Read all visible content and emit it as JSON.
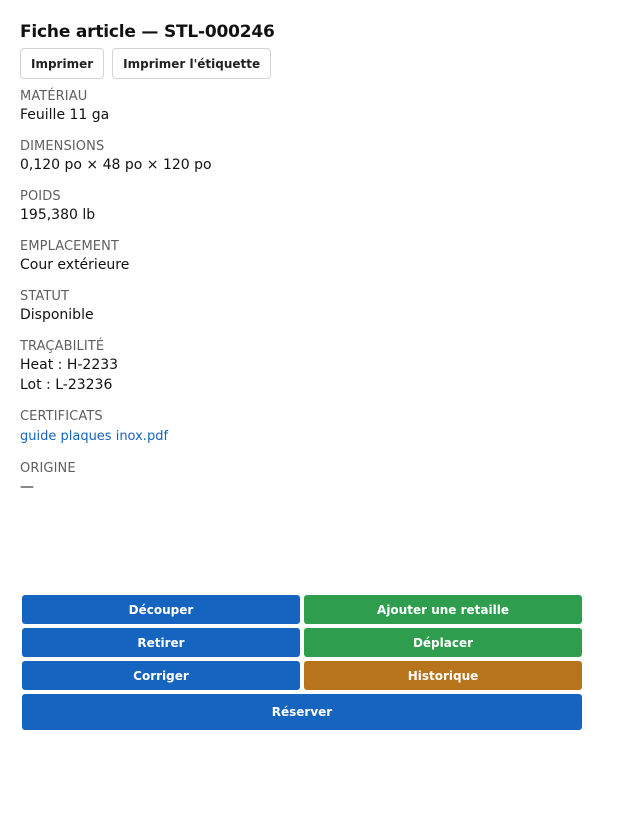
{
  "header": {
    "title": "Fiche article — STL-000246",
    "print_label": "Imprimer",
    "print_tag_label": "Imprimer l'étiquette"
  },
  "fields": {
    "material": {
      "label": "MATÉRIAU",
      "value": "Feuille 11 ga"
    },
    "dimensions": {
      "label": "DIMENSIONS",
      "value": "0,120 po × 48 po × 120 po"
    },
    "weight": {
      "label": "POIDS",
      "value": "195,380 lb"
    },
    "location": {
      "label": "EMPLACEMENT",
      "value": "Cour extérieure"
    },
    "status": {
      "label": "STATUT",
      "value": "Disponible"
    },
    "traceability": {
      "label": "TRAÇABILITÉ",
      "heat": "Heat : H-2233",
      "lot": "Lot : L-23236"
    },
    "certificates": {
      "label": "CERTIFICATS",
      "link": "guide plaques inox.pdf"
    },
    "origin": {
      "label": "ORIGINE",
      "value": "—"
    }
  },
  "actions": {
    "cut": "Découper",
    "add_remnant": "Ajouter une retaille",
    "remove": "Retirer",
    "move": "Déplacer",
    "correct": "Corriger",
    "history": "Historique",
    "reserve": "Réserver"
  },
  "colors": {
    "primary": "#1565c0",
    "success": "#2e9e4e",
    "warning": "#b8741a",
    "link": "#1565c0"
  }
}
